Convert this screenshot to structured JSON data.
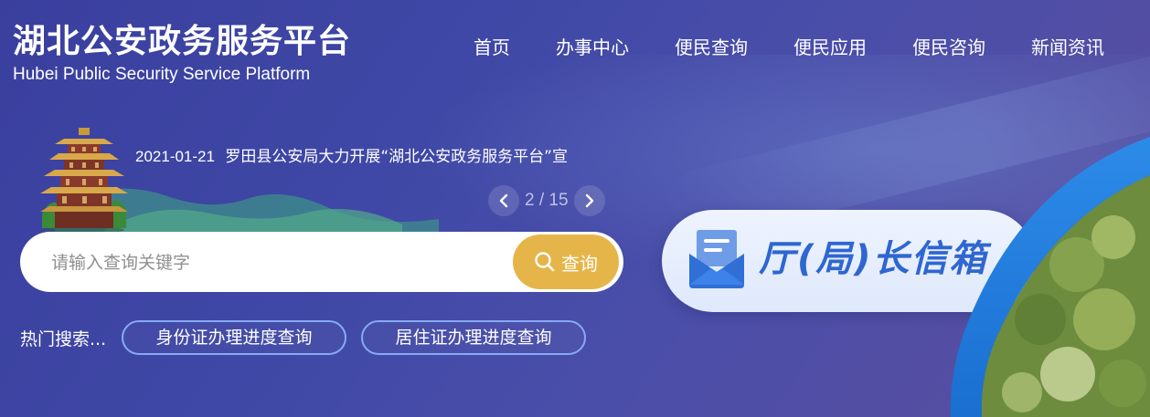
{
  "brand": {
    "title_cn": "湖北公安政务服务平台",
    "title_en": "Hubei Public Security Service Platform"
  },
  "nav": {
    "items": [
      "首页",
      "办事中心",
      "便民查询",
      "便民应用",
      "便民咨询",
      "新闻资讯"
    ]
  },
  "news": {
    "date": "2021-01-21",
    "headline": "罗田县公安局大力开展“湖北公安政务服务平台”宣",
    "pager": "2 / 15"
  },
  "search": {
    "placeholder": "请输入查询关键字",
    "button_label": "查询"
  },
  "hot_search": {
    "label": "热门搜索...",
    "tags": [
      "身份证办理进度查询",
      "居住证办理进度查询"
    ]
  },
  "mailbox": {
    "label": "厅(局)长信箱"
  },
  "icons": {
    "search": "search-icon",
    "prev": "chevron-left-icon",
    "next": "chevron-right-icon",
    "mail": "mail-icon"
  },
  "colors": {
    "background": "#3f48a6",
    "search_button": "#e6b54a",
    "tag_border": "#86aaf5",
    "mailbox_text": "#2f66d0"
  }
}
